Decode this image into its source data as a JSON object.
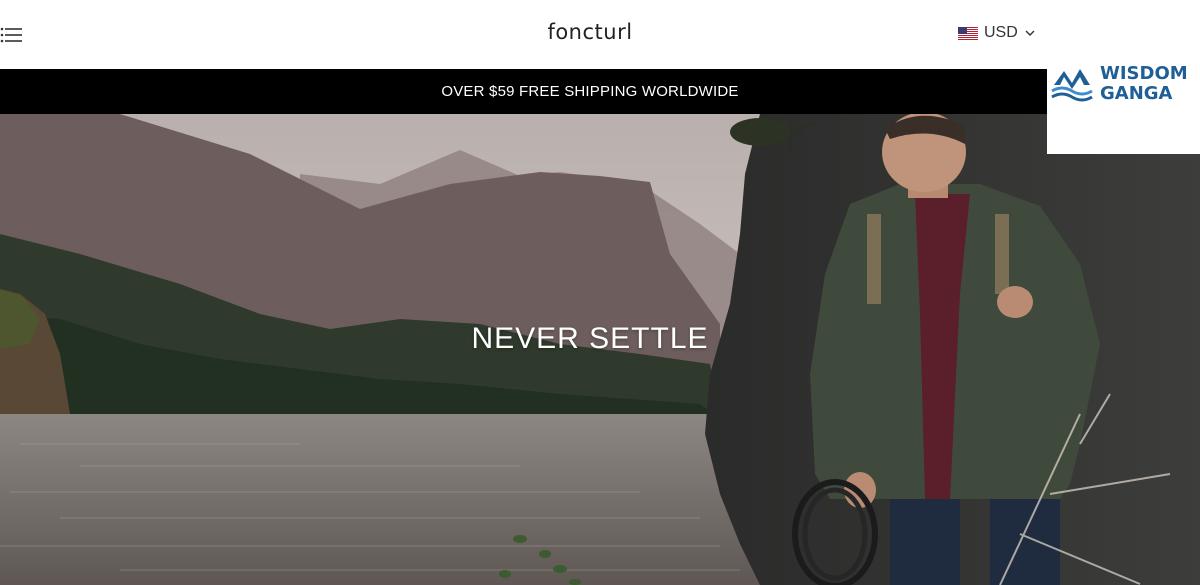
{
  "header": {
    "brand": "foncturl",
    "menu_icon": "hamburger-menu-icon",
    "currency": {
      "label": "USD",
      "flag_icon": "us-flag-icon",
      "dropdown_icon": "chevron-down-icon"
    }
  },
  "announcement": {
    "text": "OVER $59 FREE SHIPPING WORLDWIDE"
  },
  "hero": {
    "title": "NEVER SETTLE"
  },
  "watermark": {
    "line1": "WISDOM",
    "line2": "GANGA",
    "brand_color": "#1f5f95"
  },
  "colors": {
    "announcement_bg": "#000000",
    "announcement_text": "#ffffff",
    "header_bg": "#ffffff"
  }
}
